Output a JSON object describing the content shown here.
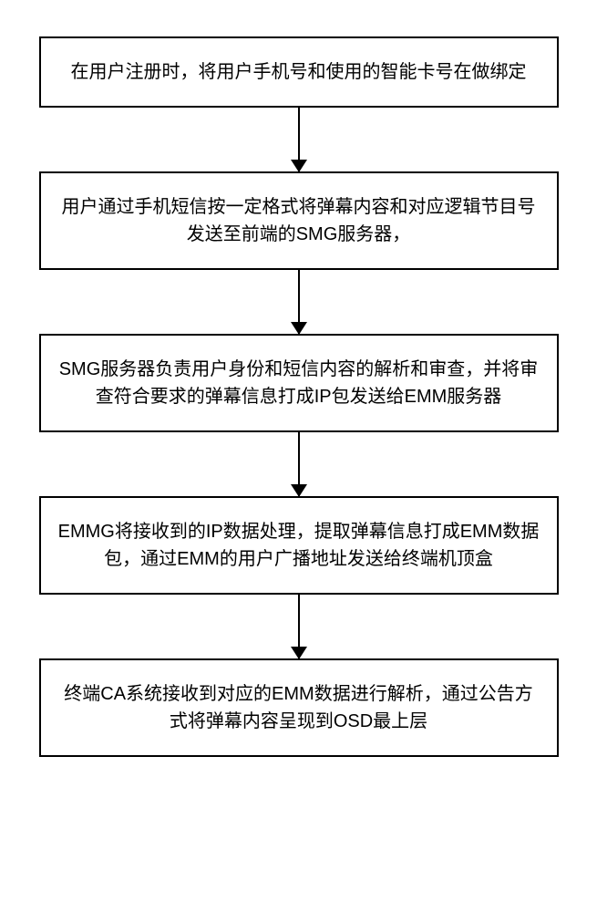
{
  "chart_data": {
    "type": "flowchart",
    "direction": "top-to-bottom",
    "steps": [
      {
        "id": 1,
        "text": "在用户注册时，将用户手机号和使用的智能卡号在做绑定"
      },
      {
        "id": 2,
        "text": "用户通过手机短信按一定格式将弹幕内容和对应逻辑节目号发送至前端的SMG服务器，"
      },
      {
        "id": 3,
        "text": "SMG服务器负责用户身份和短信内容的解析和审查，并将审查符合要求的弹幕信息打成IP包发送给EMM服务器"
      },
      {
        "id": 4,
        "text": "EMMG将接收到的IP数据处理，提取弹幕信息打成EMM数据包，通过EMM的用户广播地址发送给终端机顶盒"
      },
      {
        "id": 5,
        "text": "终端CA系统接收到对应的EMM数据进行解析，通过公告方式将弹幕内容呈现到OSD最上层"
      }
    ],
    "edges": [
      {
        "from": 1,
        "to": 2
      },
      {
        "from": 2,
        "to": 3
      },
      {
        "from": 3,
        "to": 4
      },
      {
        "from": 4,
        "to": 5
      }
    ]
  }
}
